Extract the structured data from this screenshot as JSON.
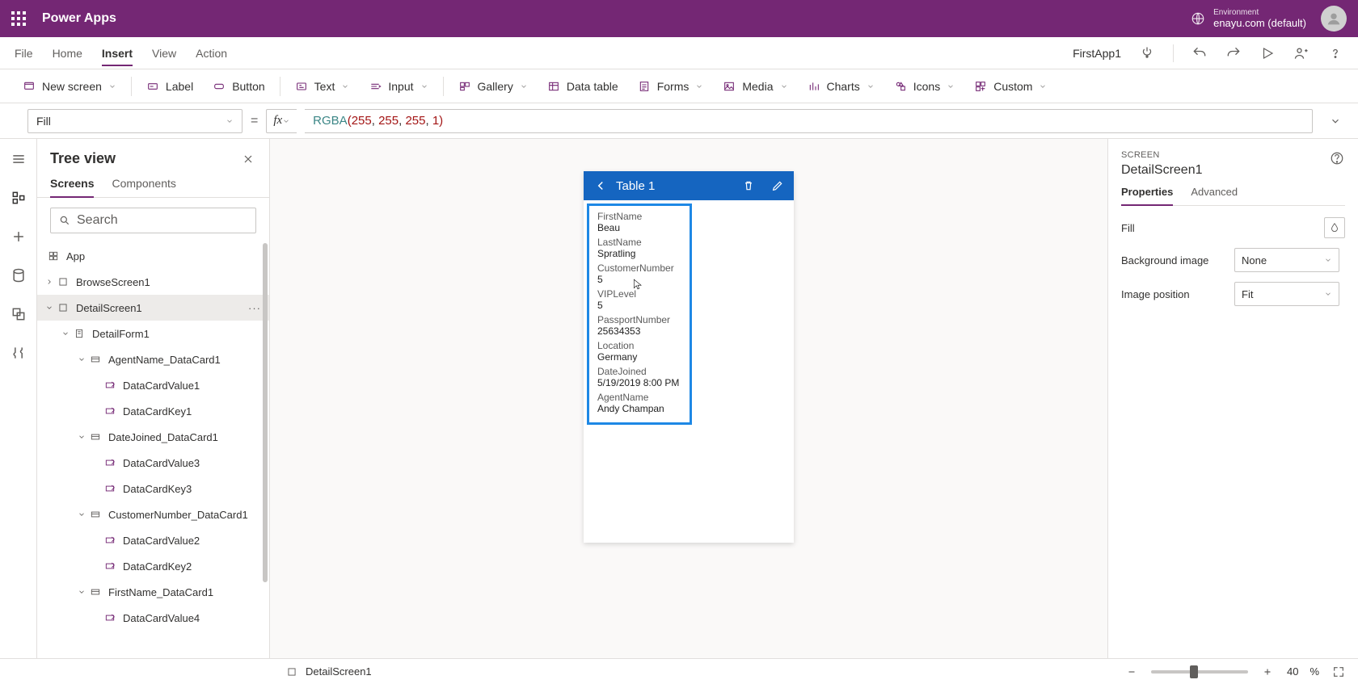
{
  "header": {
    "product": "Power Apps",
    "env_label": "Environment",
    "env_value": "enayu.com (default)"
  },
  "menu": {
    "items": [
      "File",
      "Home",
      "Insert",
      "View",
      "Action"
    ],
    "active": "Insert",
    "app_name": "FirstApp1"
  },
  "ribbon": {
    "new_screen": "New screen",
    "label": "Label",
    "button": "Button",
    "text": "Text",
    "input": "Input",
    "gallery": "Gallery",
    "data_table": "Data table",
    "forms": "Forms",
    "media": "Media",
    "charts": "Charts",
    "icons": "Icons",
    "custom": "Custom"
  },
  "formula": {
    "property": "Fill",
    "fn": "RGBA",
    "args": "255, 255, 255, 1"
  },
  "tree": {
    "title": "Tree view",
    "tab_screens": "Screens",
    "tab_components": "Components",
    "search_placeholder": "Search",
    "nodes": {
      "app": "App",
      "browse": "BrowseScreen1",
      "detail": "DetailScreen1",
      "form": "DetailForm1",
      "agent_card": "AgentName_DataCard1",
      "dcv1": "DataCardValue1",
      "dck1": "DataCardKey1",
      "date_card": "DateJoined_DataCard1",
      "dcv3": "DataCardValue3",
      "dck3": "DataCardKey3",
      "cust_card": "CustomerNumber_DataCard1",
      "dcv2": "DataCardValue2",
      "dck2": "DataCardKey2",
      "first_card": "FirstName_DataCard1",
      "dcv4": "DataCardValue4"
    }
  },
  "canvas": {
    "screen_title": "Table 1",
    "fields": [
      {
        "label": "FirstName",
        "value": "Beau"
      },
      {
        "label": "LastName",
        "value": "Spratling"
      },
      {
        "label": "CustomerNumber",
        "value": "5"
      },
      {
        "label": "VIPLevel",
        "value": "5"
      },
      {
        "label": "PassportNumber",
        "value": "25634353"
      },
      {
        "label": "Location",
        "value": "Germany"
      },
      {
        "label": "DateJoined",
        "value": "5/19/2019 8:00 PM"
      },
      {
        "label": "AgentName",
        "value": "Andy Champan"
      }
    ]
  },
  "props": {
    "category": "SCREEN",
    "name": "DetailScreen1",
    "tab_properties": "Properties",
    "tab_advanced": "Advanced",
    "fill_label": "Fill",
    "bg_label": "Background image",
    "bg_value": "None",
    "pos_label": "Image position",
    "pos_value": "Fit"
  },
  "status": {
    "breadcrumb": "DetailScreen1",
    "zoom": "40",
    "zoom_unit": "%"
  }
}
